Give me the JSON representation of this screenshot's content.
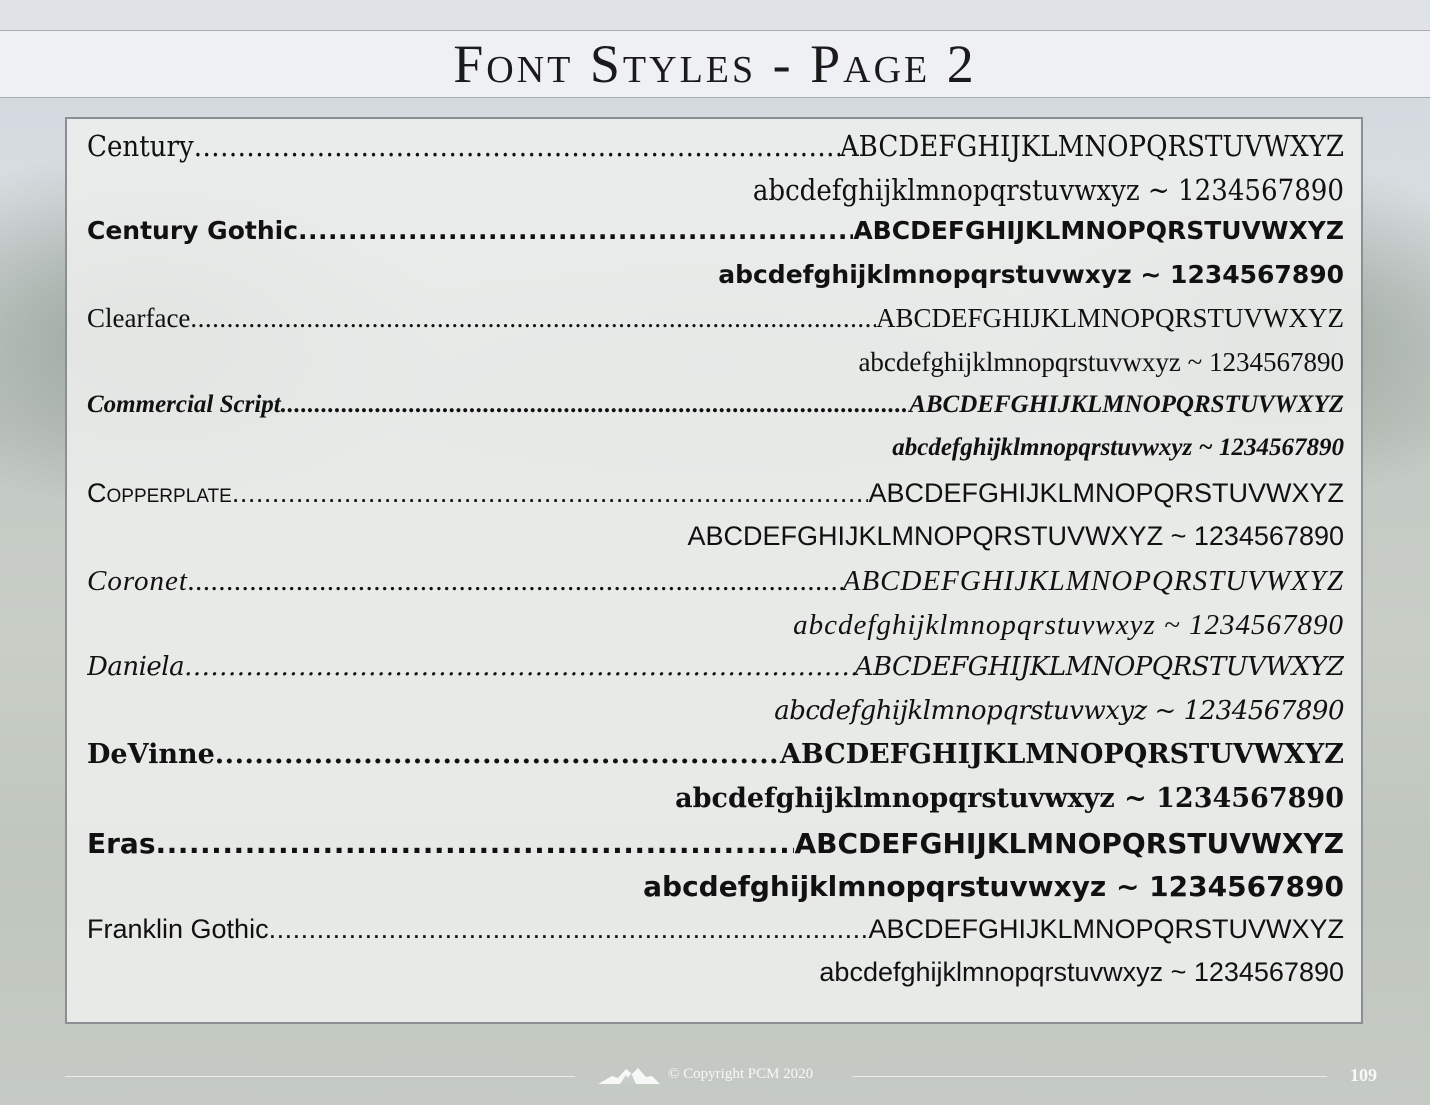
{
  "page": {
    "title": "Font Styles - Page 2",
    "page_number": "109",
    "copyright": "© Copyright PCM 2020",
    "logo_icon": "mountain-logo-icon"
  },
  "fonts": [
    {
      "name": "Century",
      "uppercase": "ABCDEFGHIJKLMNOPQRSTUVWXYZ",
      "lowercase": "abcdefghijklmnopqrstuvwxyz ~ 1234567890"
    },
    {
      "name": "Century Gothic",
      "uppercase": "ABCDEFGHIJKLMNOPQRSTUVWXYZ",
      "lowercase": "abcdefghijklmnopqrstuvwxyz ~ 1234567890"
    },
    {
      "name": "Clearface",
      "uppercase": "ABCDEFGHIJKLMNOPQRSTUVWXYZ",
      "lowercase": "abcdefghijklmnopqrstuvwxyz ~ 1234567890"
    },
    {
      "name": "Commercial Script",
      "uppercase": "ABCDEFGHIJKLMNOPQRSTUVWXYZ",
      "lowercase": "abcdefghijklmnopqrstuvwxyz ~ 1234567890"
    },
    {
      "name": "Copperplate",
      "uppercase": "ABCDEFGHIJKLMNOPQRSTUVWXYZ",
      "lowercase": "ABCDEFGHIJKLMNOPQRSTUVWXYZ ~ 1234567890"
    },
    {
      "name": "Coronet",
      "uppercase": "ABCDEFGHIJKLMNOPQRSTUVWXYZ",
      "lowercase": "abcdefghijklmnopqrstuvwxyz ~ 1234567890"
    },
    {
      "name": "Daniela",
      "uppercase": "ABCDEFGHIJKLMNOPQRSTUVWXYZ",
      "lowercase": "abcdefghijklmnopqrstuvwxyz ~ 1234567890"
    },
    {
      "name": "DeVinne",
      "uppercase": "ABCDEFGHIJKLMNOPQRSTUVWXYZ",
      "lowercase": "abcdefghijklmnopqrstuvwxyz ~ 1234567890"
    },
    {
      "name": "Eras",
      "uppercase": "ABCDEFGHIJKLMNOPQRSTUVWXYZ",
      "lowercase": "abcdefghijklmnopqrstuvwxyz ~ 1234567890"
    },
    {
      "name": "Franklin Gothic",
      "uppercase": "ABCDEFGHIJKLMNOPQRSTUVWXYZ",
      "lowercase": "abcdefghijklmnopqrstuvwxyz ~ 1234567890"
    }
  ]
}
